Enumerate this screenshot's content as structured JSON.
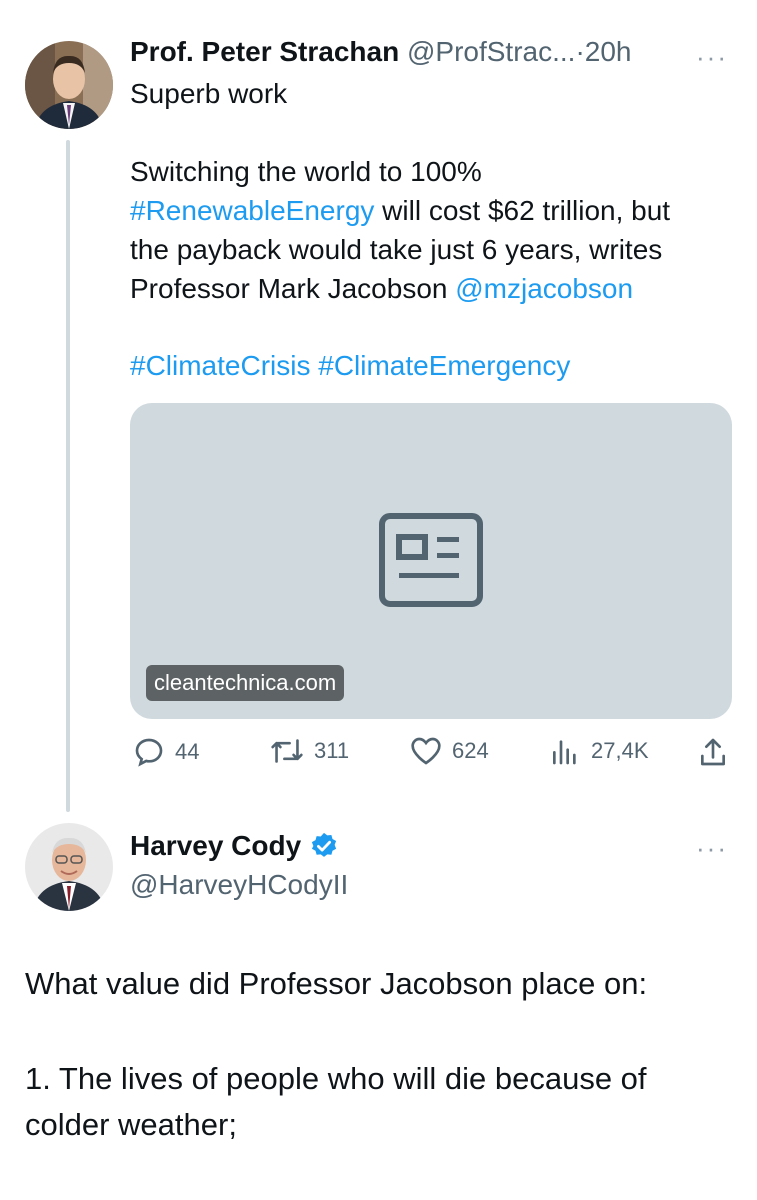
{
  "tweet1": {
    "author_name": "Prof. Peter Strachan",
    "author_handle": "@ProfStrac...",
    "separator": "·",
    "time": "20h",
    "more": "···",
    "line1": "Superb work",
    "body_line1": "Switching the world to 100%",
    "hashtag_renewable": "#RenewableEnergy",
    "body_line2_rest": " will cost $62 trillion, but",
    "body_line3": "the payback would take just 6 years, writes",
    "body_line4": "Professor Mark Jacobson ",
    "mention": "@mzjacobson",
    "hashtag_crisis": "#ClimateCrisis",
    "hashtag_emergency": "#ClimateEmergency",
    "card_domain": "cleantechnica.com",
    "card_icon": "news-article-icon",
    "actions": {
      "replies": "44",
      "retweets": "311",
      "likes": "624",
      "views": "27,4K"
    }
  },
  "tweet2": {
    "author_name": "Harvey Cody",
    "verified_icon": "verified-badge-icon",
    "author_handle": "@HarveyHCodyII",
    "more": "···",
    "line1": "What value did Professor Jacobson place on:",
    "line2": "1. The lives of people who will die because of",
    "line3": "colder weather;"
  },
  "colors": {
    "link": "#1d9bf0",
    "secondary": "#536471",
    "card_bg": "#cfd9de",
    "verified": "#1d9bf0"
  }
}
